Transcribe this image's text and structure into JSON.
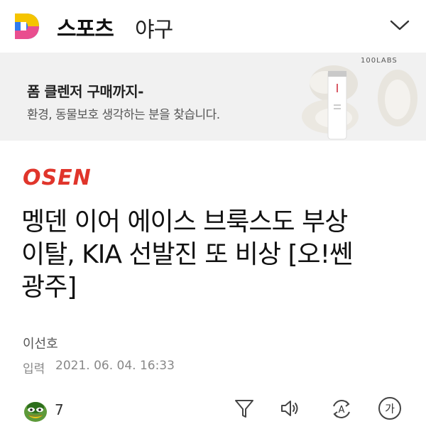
{
  "header": {
    "logo_letter": "D",
    "section": "스포츠",
    "subsection": "야구"
  },
  "ad": {
    "title": "폼 클렌저 구매까지-",
    "subtitle": "환경, 동물보호 생각하는 분을 찾습니다.",
    "brand": "100LABS"
  },
  "article": {
    "source_logo": "OSEN",
    "headline_lines": [
      "멩덴 이어 에이스 브룩스도 부상",
      "이탈, KIA 선발진 또 비상 [오!쎈",
      "광주]"
    ],
    "author": "이선호",
    "date_label": "입력",
    "date": "2021. 06. 04. 16:33"
  },
  "actions": {
    "reaction_count": "7",
    "font_button": "가",
    "translate_button": "A",
    "icons": [
      "reaction-icon",
      "filter-icon",
      "speaker-icon",
      "translate-icon",
      "font-size-icon"
    ]
  },
  "colors": {
    "logo_blue": "#2f7bf0",
    "logo_yellow": "#f5c400",
    "osen_red": "#e0352b",
    "ad_bg": "#f1f1f1"
  }
}
